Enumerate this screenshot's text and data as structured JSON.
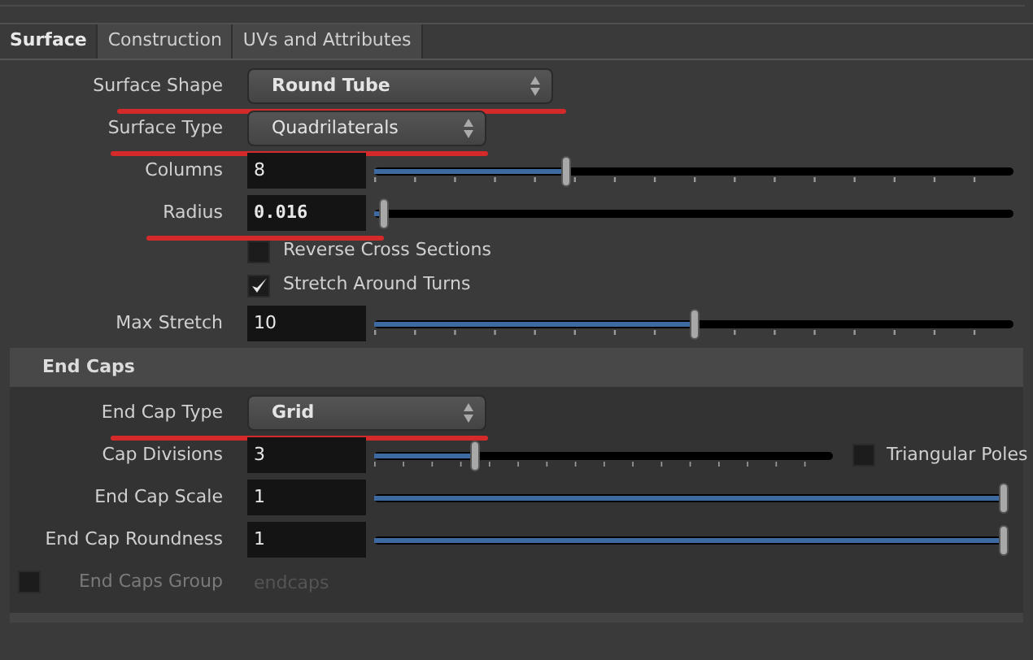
{
  "tabs": [
    {
      "label": "Surface",
      "selected": true
    },
    {
      "label": "Construction",
      "selected": false
    },
    {
      "label": "UVs and Attributes",
      "selected": false
    }
  ],
  "surface_rows": [
    {
      "kind": "dropdown",
      "label": "Surface Shape",
      "value": "Round Tube",
      "bold": true,
      "underlined": true,
      "wide": true
    },
    {
      "kind": "dropdown",
      "label": "Surface Type",
      "value": "Quadrilaterals",
      "bold": false,
      "underlined": true,
      "wide": false
    },
    {
      "kind": "slider",
      "label": "Columns",
      "value": "8",
      "bold": false,
      "level": 0.3,
      "ticks": true,
      "underlined": false
    },
    {
      "kind": "slider",
      "label": "Radius",
      "value": "0.016",
      "bold": true,
      "level": 0.015,
      "ticks": false,
      "underlined": true
    },
    {
      "kind": "checkbox",
      "label": "Reverse Cross Sections",
      "checked": false
    },
    {
      "kind": "checkbox",
      "label": "Stretch Around Turns",
      "checked": true
    },
    {
      "kind": "slider",
      "label": "Max Stretch",
      "value": "10",
      "bold": false,
      "level": 0.5,
      "ticks": true,
      "underlined": false
    }
  ],
  "end_caps": {
    "title": "End Caps",
    "rows": [
      {
        "kind": "dropdown",
        "label": "End Cap Type",
        "value": "Grid",
        "bold": true,
        "underlined": true,
        "wide": false
      },
      {
        "kind": "slider",
        "label": "Cap Divisions",
        "value": "3",
        "bold": false,
        "level": 0.22,
        "ticks": true,
        "underlined": false,
        "option": {
          "label": "Triangular Poles",
          "checked": false
        }
      },
      {
        "kind": "slider",
        "label": "End Cap Scale",
        "value": "1",
        "bold": false,
        "level": 1,
        "ticks": false,
        "underlined": false
      },
      {
        "kind": "slider",
        "label": "End Cap Roundness",
        "value": "1",
        "bold": false,
        "level": 1,
        "ticks": false,
        "underlined": false
      },
      {
        "kind": "toggle_field",
        "label": "End Caps Group",
        "placeholder": "endcaps",
        "checked": false,
        "disabled": true
      }
    ]
  }
}
